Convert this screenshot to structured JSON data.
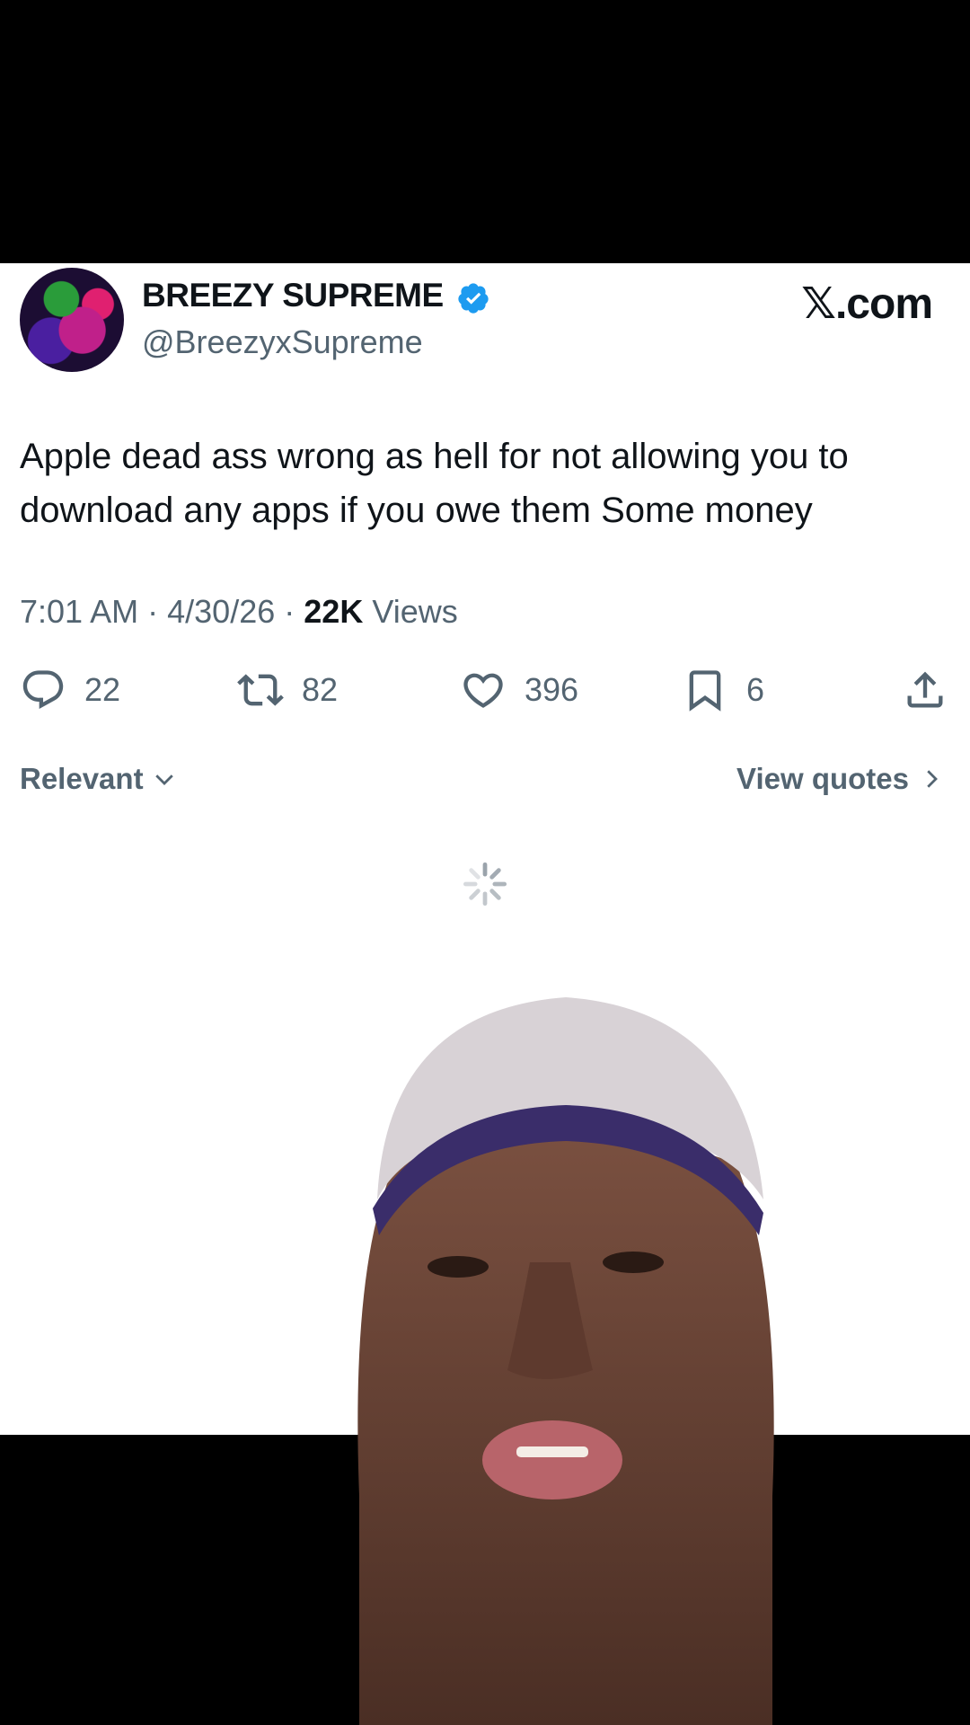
{
  "author": {
    "display_name": "BREEZY SUPREME",
    "handle": "@BreezyxSupreme",
    "verified": true
  },
  "brand": "𝕏.com",
  "tweet": {
    "text": "Apple dead ass wrong as hell for not allowing you to download any apps if you owe them Some money",
    "time": "7:01 AM",
    "date": "4/30/26",
    "views_count": "22K",
    "views_label": "Views",
    "separator": "·"
  },
  "actions": {
    "replies": "22",
    "reposts": "82",
    "likes": "396",
    "bookmarks": "6"
  },
  "sort": {
    "label": "Relevant",
    "view_quotes": "View quotes"
  },
  "colors": {
    "text_primary": "#0f1419",
    "text_secondary": "#536471",
    "verified_blue": "#1d9bf0",
    "background_card": "#ffffff",
    "background_outer": "#000000"
  },
  "icons": [
    "reply-icon",
    "repost-icon",
    "like-icon",
    "bookmark-icon",
    "share-icon",
    "verified-icon",
    "chevron-down-icon",
    "chevron-right-icon",
    "loading-spinner-icon"
  ]
}
